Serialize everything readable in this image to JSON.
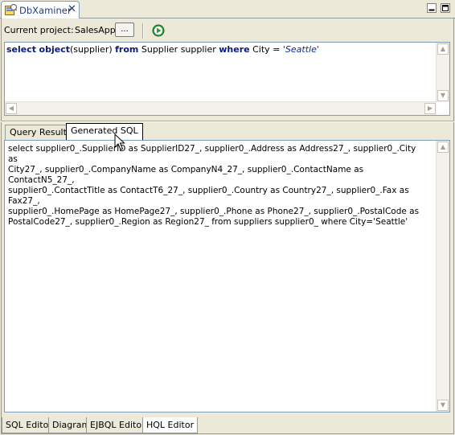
{
  "view": {
    "tab_title": "DbXaminer",
    "close_glyph": "✕",
    "icons": {
      "view": "db-examiner-icon",
      "minimize": "minimize-icon",
      "maximize": "maximize-icon"
    }
  },
  "toolbar": {
    "project_label": "Current project:",
    "project_name": "SalesApp",
    "browse_label": "...",
    "run_icon": "run-icon"
  },
  "query": {
    "tokens": [
      "select",
      "object",
      "(supplier)",
      "from",
      "Supplier supplier",
      "where",
      "City =",
      "'Seattle'"
    ]
  },
  "results": {
    "tabs": [
      {
        "label": "Query Result",
        "active": false
      },
      {
        "label": "Generated SQL",
        "active": true
      }
    ],
    "sql_lines": [
      "select supplier0_.SupplierID as SupplierID27_, supplier0_.Address as Address27_, supplier0_.City as",
      "City27_, supplier0_.CompanyName as CompanyN4_27_, supplier0_.ContactName as ContactN5_27_,",
      "supplier0_.ContactTitle as ContactT6_27_, supplier0_.Country as Country27_, supplier0_.Fax as Fax27_,",
      "supplier0_.HomePage as HomePage27_, supplier0_.Phone as Phone27_, supplier0_.PostalCode as",
      "PostalCode27_, supplier0_.Region as Region27_ from suppliers supplier0_ where City='Seattle'"
    ]
  },
  "bottom_tabs": [
    {
      "label": "SQL Editor",
      "active": false
    },
    {
      "label": "Diagram",
      "active": false
    },
    {
      "label": "EJBQL Editor",
      "active": false
    },
    {
      "label": "HQL Editor",
      "active": true
    }
  ],
  "colors": {
    "keyword": "#0a1a7a",
    "run": "#2e9e3a",
    "tab_border": "#919b9c"
  }
}
